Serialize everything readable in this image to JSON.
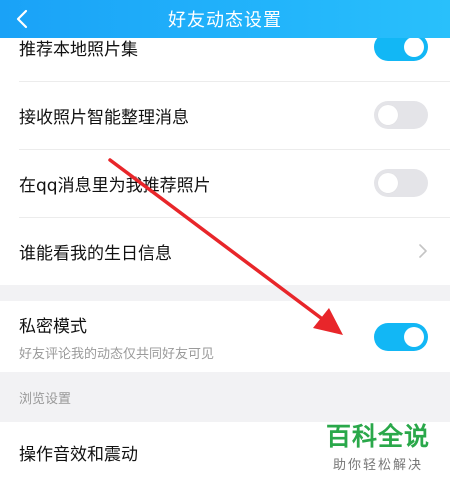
{
  "header": {
    "title": "好友动态设置"
  },
  "group1": [
    {
      "label": "推荐本地照片集",
      "control": "toggle",
      "on": true
    },
    {
      "label": "接收照片智能整理消息",
      "control": "toggle",
      "on": false
    },
    {
      "label": "在qq消息里为我推荐照片",
      "control": "toggle",
      "on": false
    },
    {
      "label": "谁能看我的生日信息",
      "control": "chevron"
    }
  ],
  "private_mode": {
    "label": "私密模式",
    "subtitle": "好友评论我的动态仅共同好友可见",
    "on": true
  },
  "section_browse": {
    "title": "浏览设置"
  },
  "browse_items": [
    {
      "label": "操作音效和震动"
    }
  ],
  "watermark": {
    "main": "百科全说",
    "sub": "助你轻松解决"
  },
  "colors": {
    "accent": "#12b7f5",
    "toggle_off": "#e4e4e8",
    "annotation_arrow": "#e8262a",
    "watermark_green": "#2aa84a"
  }
}
